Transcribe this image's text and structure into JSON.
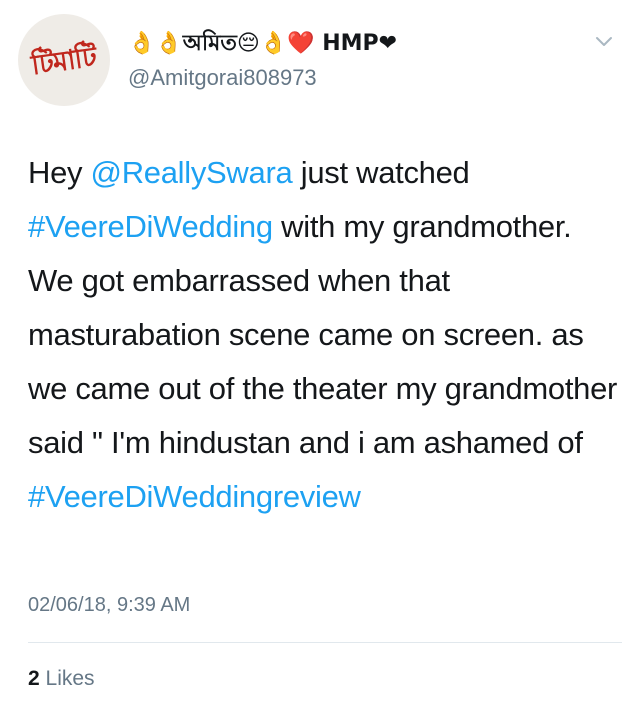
{
  "author": {
    "avatar_text": "টিমাটি",
    "display_name": "👌👌অমিত😔👌❤️ HMP❤",
    "handle": "@Amitgorai808973"
  },
  "menu": {
    "icon": "chevron-down-icon"
  },
  "tweet": {
    "segments": [
      {
        "text": "Hey ",
        "link": false
      },
      {
        "text": "@ReallySwara",
        "link": true
      },
      {
        "text": " just watched ",
        "link": false
      },
      {
        "text": "#VeereDiWedding",
        "link": true
      },
      {
        "text": " with my grandmother. We got embarrassed when that masturabation scene came on screen. as we came out of the theater my grandmother said \" I'm hindustan and i am ashamed of ",
        "link": false
      },
      {
        "text": "#VeereDiWeddingreview",
        "link": true
      }
    ],
    "timestamp": "02/06/18, 9:39 AM"
  },
  "stats": {
    "likes_count": "2",
    "likes_label": "Likes"
  },
  "colors": {
    "link": "#1da1f2",
    "secondary_text": "#657786",
    "primary_text": "#14171a",
    "divider": "#e1e8ed",
    "avatar_text": "#c0271d"
  }
}
